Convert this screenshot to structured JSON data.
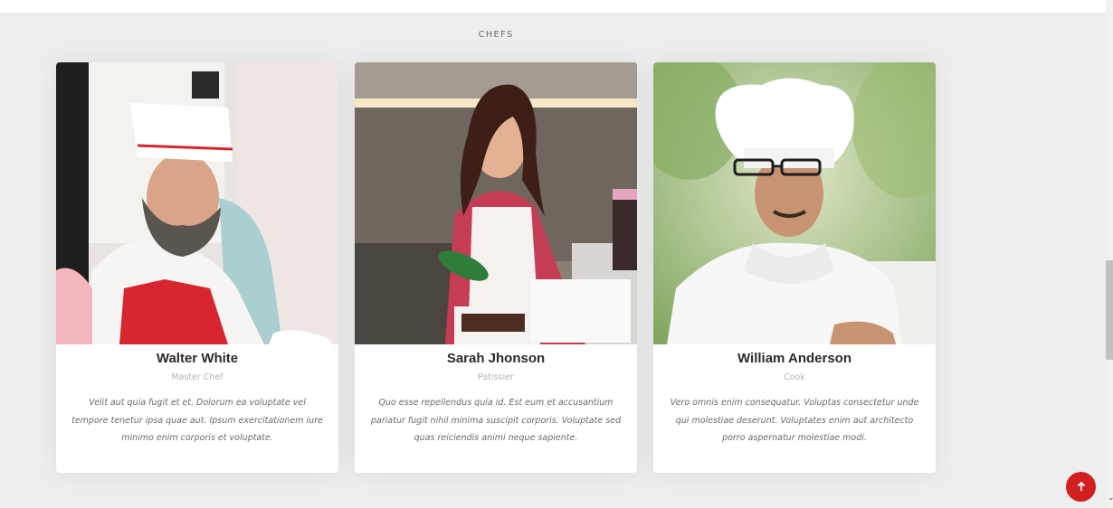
{
  "section": {
    "title": "CHEFS"
  },
  "chefs": [
    {
      "name": "Walter White",
      "role": "Master Chef",
      "bio": "Velit aut quia fugit et et. Dolorum ea voluptate vel tempore tenetur ipsa quae aut. Ipsum exercitationem iure minimo enim corporis et voluptate.",
      "photo_icon": "chef-photo-walter"
    },
    {
      "name": "Sarah Jhonson",
      "role": "Patissier",
      "bio": "Quo esse repellendus quia id. Est eum et accusantium pariatur fugit nihil minima suscipit corporis. Voluptate sed quas reiciendis animi neque sapiente.",
      "photo_icon": "chef-photo-sarah"
    },
    {
      "name": "William Anderson",
      "role": "Cook",
      "bio": "Vero omnis enim consequatur. Voluptas consectetur unde qui molestiae deserunt. Voluptates enim aut architecto porro aspernatur molestiae modi.",
      "photo_icon": "chef-photo-william"
    }
  ],
  "back_to_top": {
    "icon": "arrow-up-icon",
    "color": "#d21f1f"
  },
  "colors": {
    "page_background": "#eeeeee",
    "card_background": "#ffffff",
    "accent_red": "#d21f1f"
  }
}
